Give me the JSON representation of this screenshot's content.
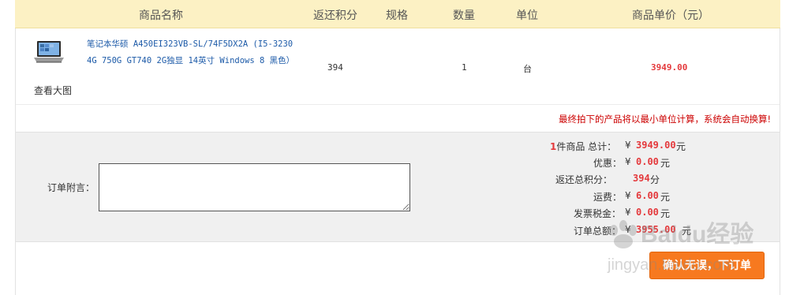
{
  "header": {
    "col_name": "商品名称",
    "col_points": "返还积分",
    "col_spec": "规格",
    "col_qty": "数量",
    "col_unit": "单位",
    "col_price": "商品单价（元）"
  },
  "item": {
    "name_line1": "笔记本华硕 A450EI323VB-SL/74F5DX2A (I5-3230",
    "name_line2": "4G 750G GT740 2G独显 14英寸 Windows 8 黑色）",
    "view_large": "查看大图",
    "points": "394",
    "qty": "1",
    "unit": "台",
    "price": "3949.00"
  },
  "notice": "最终拍下的产品将以最小单位计算，系统会自动换算!",
  "order_note": {
    "label": "订单附言：",
    "value": ""
  },
  "summary": {
    "count": "1",
    "count_label": "件商品 总计：",
    "currency": "¥",
    "total": "3949.00",
    "yuan": "元",
    "discount_label": "优惠：",
    "discount": "0.00",
    "points_label": "返还总积分：",
    "points": "394",
    "points_unit": "分",
    "shipping_label": "运费：",
    "shipping": "6.00",
    "tax_label": "发票税金：",
    "tax": "0.00",
    "order_total_label": "订单总额：",
    "order_total": "3955.00"
  },
  "confirm_button": "确认无误，下订单",
  "watermark": {
    "brand": "Baidu经验",
    "url": "jingyan.baidu.com"
  },
  "colors": {
    "header_bg": "#fcf1c4",
    "price_red": "#e4393c",
    "link_blue": "#1c5aa8",
    "button_orange": "#f7791f"
  }
}
